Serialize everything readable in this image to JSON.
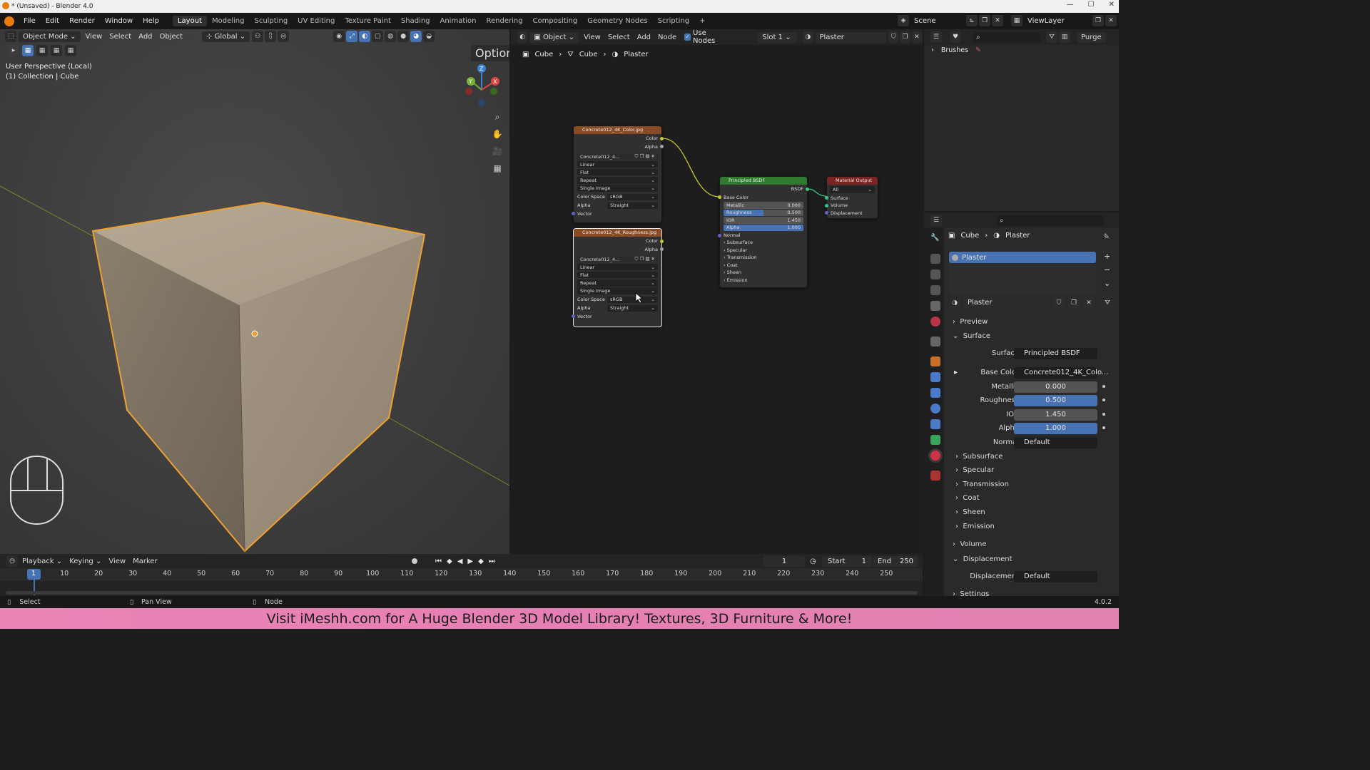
{
  "window": {
    "title": "* (Unsaved) - Blender 4.0"
  },
  "menubar": {
    "menus": [
      "File",
      "Edit",
      "Render",
      "Window",
      "Help"
    ],
    "workspaces": [
      "Layout",
      "Modeling",
      "Sculpting",
      "UV Editing",
      "Texture Paint",
      "Shading",
      "Animation",
      "Rendering",
      "Compositing",
      "Geometry Nodes",
      "Scripting"
    ],
    "active_workspace": "Layout",
    "add_tab": "+",
    "scene": "Scene",
    "view_layer": "ViewLayer"
  },
  "viewport": {
    "mode": "Object Mode",
    "menus": [
      "View",
      "Select",
      "Add",
      "Object"
    ],
    "orientation": "Global",
    "options": "Options",
    "overlay_line1": "User Perspective (Local)",
    "overlay_line2": "(1) Collection | Cube",
    "gizmo": {
      "z": "Z",
      "y": "Y",
      "x": "X"
    }
  },
  "node_editor": {
    "object_dropdown": "Object",
    "menus": [
      "View",
      "Select",
      "Add",
      "Node"
    ],
    "use_nodes": "Use Nodes",
    "slot": "Slot 1",
    "material": "Plaster",
    "breadcrumb": [
      "Cube",
      "Cube",
      "Plaster"
    ],
    "tex1": {
      "title": "Concrete012_4K_Color.jpg",
      "out_color": "Color",
      "out_alpha": "Alpha",
      "image": "Concrete012_4...",
      "interp": "Linear",
      "proj": "Flat",
      "ext": "Repeat",
      "source": "Single Image",
      "cs_label": "Color Space",
      "cs": "sRGB",
      "alpha_label": "Alpha",
      "alpha": "Straight",
      "vector": "Vector"
    },
    "tex2": {
      "title": "Concrete012_4K_Roughness.jpg",
      "out_color": "Color",
      "out_alpha": "Alpha",
      "image": "Concrete012_4...",
      "interp": "Linear",
      "proj": "Flat",
      "ext": "Repeat",
      "source": "Single Image",
      "cs_label": "Color Space",
      "cs": "sRGB",
      "alpha_label": "Alpha",
      "alpha": "Straight",
      "vector": "Vector"
    },
    "bsdf": {
      "title": "Principled BSDF",
      "out": "BSDF",
      "base_color": "Base Color",
      "metallic_label": "Metallic",
      "metallic": "0.000",
      "roughness_label": "Roughness",
      "roughness": "0.500",
      "ior_label": "IOR",
      "ior": "1.450",
      "alpha_label": "Alpha",
      "alpha": "1.000",
      "normal": "Normal",
      "sections": [
        "Subsurface",
        "Specular",
        "Transmission",
        "Coat",
        "Sheen",
        "Emission"
      ]
    },
    "output": {
      "title": "Material Output",
      "target": "All",
      "inputs": [
        "Surface",
        "Volume",
        "Displacement"
      ]
    }
  },
  "outliner": {
    "item": "Brushes",
    "purge": "Purge"
  },
  "properties": {
    "breadcrumb": [
      "Cube",
      "Plaster"
    ],
    "slot_item": "Plaster",
    "material_name": "Plaster",
    "preview": "Preview",
    "surface_section": "Surface",
    "surface_label": "Surface",
    "surface_value": "Principled BSDF",
    "base_color_label": "Base Color",
    "base_color_value": "Concrete012_4K_Colo...",
    "metallic_label": "Metallic",
    "metallic": "0.000",
    "roughness_label": "Roughness",
    "roughness": "0.500",
    "ior_label": "IOR",
    "ior": "1.450",
    "alpha_label": "Alpha",
    "alpha": "1.000",
    "normal_label": "Normal",
    "normal_value": "Default",
    "subsections": [
      "Subsurface",
      "Specular",
      "Transmission",
      "Coat",
      "Sheen",
      "Emission"
    ],
    "volume": "Volume",
    "displacement_section": "Displacement",
    "displacement_label": "Displacement",
    "displacement_value": "Default",
    "settings": "Settings"
  },
  "timeline": {
    "menus": [
      "Playback",
      "Keying",
      "View",
      "Marker"
    ],
    "current_frame": "1",
    "start_label": "Start",
    "start": "1",
    "end_label": "End",
    "end": "250",
    "ticks": [
      "1",
      "10",
      "20",
      "30",
      "40",
      "50",
      "60",
      "70",
      "80",
      "90",
      "100",
      "110",
      "120",
      "130",
      "140",
      "150",
      "160",
      "170",
      "180",
      "190",
      "200",
      "210",
      "220",
      "230",
      "240",
      "250"
    ]
  },
  "status": {
    "select": "Select",
    "pan": "Pan View",
    "node": "Node",
    "version": "4.0.2"
  },
  "banner": {
    "text": "Visit iMeshh.com for A Huge Blender 3D Model Library! Textures, 3D Furniture & More!"
  },
  "colors": {
    "accent_blue": "#4772b3",
    "selection_orange": "#f0a030",
    "texture_header": "#8a4a24",
    "shader_header": "#2f7a2f",
    "output_header": "#7a2424",
    "banner_pink": "#ec84b6"
  },
  "icons": [
    "blender-logo-icon",
    "search-icon",
    "filter-icon",
    "pin-icon",
    "close-icon",
    "shield-icon",
    "copy-icon",
    "camera-icon",
    "hand-icon",
    "zoom-icon",
    "grid-icon",
    "play-icon"
  ]
}
